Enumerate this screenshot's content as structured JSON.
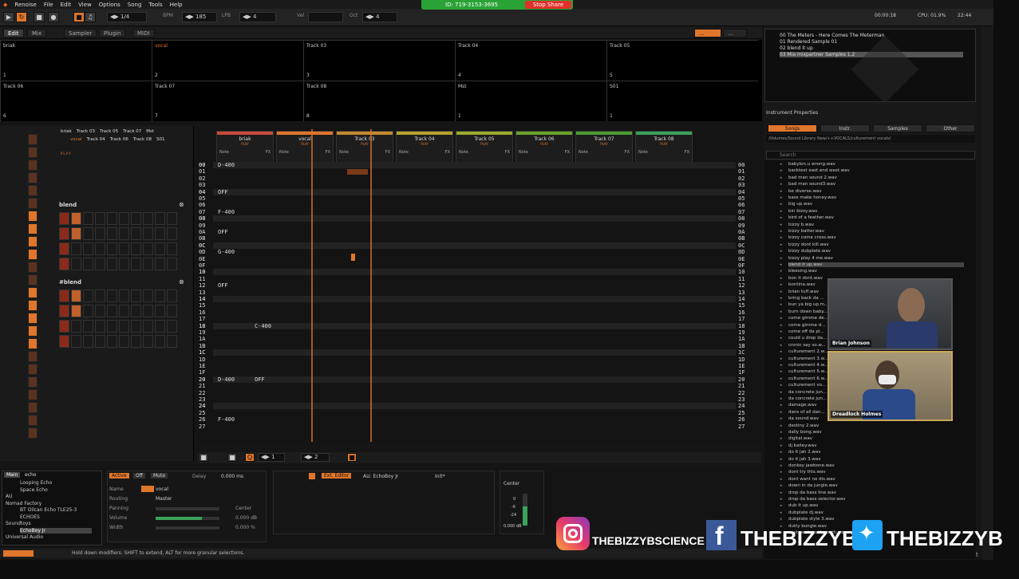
{
  "menu": {
    "app_name": "Renoise",
    "items": [
      "File",
      "Edit",
      "View",
      "Options",
      "Song",
      "Tools",
      "Help"
    ]
  },
  "share": {
    "meeting_id": "ID: 719-3153-3695",
    "stop_label": "Stop Share"
  },
  "toolbar": {
    "pattern_pos": "1/4",
    "bpm_label": "BPM",
    "bpm": "185",
    "lpb_label": "LPB",
    "lpb": "4",
    "vel_label": "Vel",
    "oct_label": "Oct",
    "oct": "4",
    "time": "00:00:18",
    "cpu": "CPU: 01.9%",
    "clock": "22:44"
  },
  "tabs": [
    "Edit",
    "Mix",
    "Sampler",
    "Plugin",
    "MIDI"
  ],
  "scopes": {
    "row1": [
      {
        "name": "briak",
        "num": "1"
      },
      {
        "name": "vocal",
        "num": "2"
      },
      {
        "name": "Track 03",
        "num": "3"
      },
      {
        "name": "Track 04",
        "num": "4"
      },
      {
        "name": "Track 05",
        "num": "5"
      }
    ],
    "row2": [
      {
        "name": "Track 06",
        "num": "6"
      },
      {
        "name": "Track 07",
        "num": "7"
      },
      {
        "name": "Track 08",
        "num": "8"
      },
      {
        "name": "Mst",
        "num": "1"
      },
      {
        "name": "S01",
        "num": "1"
      }
    ]
  },
  "mixer": {
    "track_names_top": [
      "briak",
      "Track 03",
      "Track 05",
      "Track 07",
      "Mst"
    ],
    "track_names_bottom": [
      "vocal",
      "Track 04",
      "Track 06",
      "Track 08",
      "S01"
    ],
    "play_label": "PLAY",
    "blend_label": "blend",
    "blend2_label": "#blend"
  },
  "pattern": {
    "columns": [
      {
        "name": "briak",
        "color": "#c94a3b"
      },
      {
        "name": "vocal",
        "color": "#e0762b"
      },
      {
        "name": "Track 03",
        "color": "#c38a2e"
      },
      {
        "name": "Track 04",
        "color": "#b8a22f"
      },
      {
        "name": "Track 05",
        "color": "#9aaa2c"
      },
      {
        "name": "Track 06",
        "color": "#6aa32c"
      },
      {
        "name": "Track 07",
        "color": "#4a9c30"
      },
      {
        "name": "Track 08",
        "color": "#3aa25a"
      }
    ],
    "play_label": "PLAY",
    "note_label": "Note",
    "fx_label": "FX",
    "rows": [
      "00",
      "01",
      "02",
      "03",
      "04",
      "05",
      "06",
      "07",
      "08",
      "09",
      "0A",
      "0B",
      "0C",
      "0D",
      "0E",
      "0F",
      "10",
      "11",
      "12",
      "13",
      "14",
      "15",
      "16",
      "17",
      "18",
      "19",
      "1A",
      "1B",
      "1C",
      "1D",
      "1E",
      "1F",
      "20",
      "21",
      "22",
      "23",
      "24",
      "25",
      "26",
      "27"
    ],
    "notes": [
      {
        "row": 0,
        "col": 0,
        "text": "D-400"
      },
      {
        "row": 4,
        "col": 0,
        "text": "OFF"
      },
      {
        "row": 7,
        "col": 0,
        "text": "F-400"
      },
      {
        "row": 10,
        "col": 0,
        "text": "OFF"
      },
      {
        "row": 13,
        "col": 0,
        "text": "G-400"
      },
      {
        "row": 18,
        "col": 0,
        "text": "OFF"
      },
      {
        "row": 24,
        "col": 0,
        "text": "C-400"
      },
      {
        "row": 32,
        "col": 0,
        "text": "D-400"
      },
      {
        "row": 32,
        "col": 1,
        "text": "OFF"
      },
      {
        "row": 38,
        "col": 0,
        "text": "F-400"
      }
    ],
    "footer": {
      "oct": "1",
      "step": "2"
    }
  },
  "songs": [
    {
      "idx": "00",
      "name": "The Meters - Here Comes The Meterman"
    },
    {
      "idx": "01",
      "name": "Rendered Sample 01"
    },
    {
      "idx": "02",
      "name": "blend it up"
    },
    {
      "idx": "03",
      "name": "Mia mixpartner Samples 1,2"
    }
  ],
  "instrument": {
    "header": "Instrument Properties",
    "subtabs": [
      "Songs",
      "Instr.",
      "Samples",
      "Other"
    ],
    "path": "/Volumes/Sound Library New/++VOCALS/culturement vocals/",
    "search_placeholder": "Search"
  },
  "files": [
    "babylon.u wrong.wav",
    "backtest east end west.wav",
    "bad man sound 2.wav",
    "bad man sound3.wav",
    "be diverse.wav",
    "bass make honey.wav",
    "big up.wav",
    "bin bizzy.wav",
    "bird of a feather.wav",
    "bizzy b.wav",
    "bizzy batter.wav",
    "bizzy come cross.wav",
    "bizzy dont kill.wav",
    "bizzy dubplate.wav",
    "bizzy play 4 me.wav",
    "blend it up.wav",
    "bleesing.wav",
    "bon it dont.wav",
    "bontina.wav",
    "brian tuff.wav",
    "bring back da ...",
    "bun ya big up.m...",
    "burn down baby...",
    "come gimme de...",
    "come gimme d...",
    "come off da pl...",
    "could u drop da...",
    "cronic say so.w...",
    "culturement 2.w...",
    "culturement 3.w...",
    "culturement 4.w...",
    "culturement 5.w...",
    "culturement 6.w...",
    "culturement vo...",
    "da concrete jun...",
    "da concrete jun...",
    "damage.wav",
    "dans of all dan...",
    "da sound.wav",
    "destiny 2.wav",
    "dally bong.wav",
    "digital.wav",
    "dj bailey.wav",
    "do it jah 2.wav",
    "do it jah 3.wav",
    "donkey jawbone.wav",
    "dont try this.wav",
    "dont want no dis.wav",
    "down in da jungle.wav",
    "drop da bass line.wav",
    "drop da bass selector.wav",
    "dub it up.wav",
    "dubplate dj.wav",
    "dubplate style 3.wav",
    "dutty bungle.wav",
    "east west north south.wav"
  ],
  "bottom": {
    "dsp_tab": "Main",
    "dsp_search": "echo",
    "dsp_items": [
      "Looping Echo",
      "Space Echo",
      "AU",
      "Nomad Factory",
      "BT Oilcan Echo TLE25-3",
      "ECHOES",
      "Soundtoys",
      "EchoBoy Jr",
      "Universal Audio"
    ],
    "active_label": "Active",
    "off_label": "Off",
    "mute_label": "Mute",
    "delay_label": "Delay",
    "delay_value": "0.000 ms",
    "name_label": "Name",
    "name_value": "vocal",
    "routing_label": "Routing",
    "routing_value": "Master",
    "panning_label": "Panning",
    "panning_value": "Center",
    "volume_label": "Volume",
    "volume_value": "0.000 dB",
    "width_label": "Width",
    "width_value": "0.000 %",
    "ext_editor": "Ext. Editor",
    "device_name": "AU: EchoBoy Jr",
    "device_preset": "Init*",
    "center_label": "Center",
    "db_marks": [
      "0",
      "-6",
      "-24"
    ],
    "master_db": "0.000 dB"
  },
  "status": {
    "message": "Hold down modifiers: SHIFT to extend, ALT for more granular selections.",
    "brand": "renoise"
  },
  "webcams": [
    {
      "name": "Brian Johnson"
    },
    {
      "name": "Dreadlock Holmes"
    }
  ],
  "social": {
    "instagram": "THEBIZZYBSCIENCE",
    "facebook": "THEBIZZYB",
    "twitter": "THEBIZZYB"
  }
}
